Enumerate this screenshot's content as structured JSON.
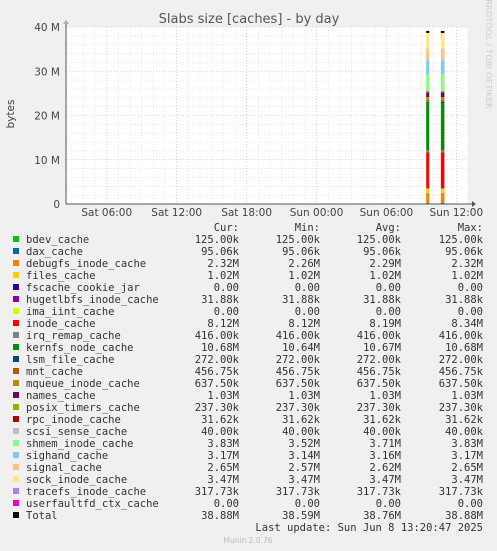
{
  "chart_data": {
    "type": "area",
    "title": "Slabs size [caches] - by day",
    "ylabel": "bytes",
    "side_label": "RRDTOOL / TOBI OETIKER",
    "y_ticks": [
      {
        "value": 0,
        "label": "0"
      },
      {
        "value": 10000000,
        "label": "10 M"
      },
      {
        "value": 20000000,
        "label": "20 M"
      },
      {
        "value": 30000000,
        "label": "30 M"
      },
      {
        "value": 40000000,
        "label": "40 M"
      }
    ],
    "ylim": [
      0,
      40000000
    ],
    "x_range_hours": [
      -33.5,
      1.0
    ],
    "x_ticks": [
      {
        "hour": -30,
        "label": "Sat 06:00"
      },
      {
        "hour": -24,
        "label": "Sat 12:00"
      },
      {
        "hour": -18,
        "label": "Sat 18:00"
      },
      {
        "hour": -12,
        "label": "Sun 00:00"
      },
      {
        "hour": -6,
        "label": "Sun 06:00"
      },
      {
        "hour": 0,
        "label": "Sun 12:00"
      }
    ],
    "data_start_hours": [
      -2.5,
      -1.2
    ],
    "columns": [
      "Cur:",
      "Min:",
      "Avg:",
      "Max:"
    ],
    "series": [
      {
        "name": "bdev_cache",
        "color": "#00cc00",
        "value": 125000,
        "cur": "125.00k",
        "min": "125.00k",
        "avg": "125.00k",
        "max": "125.00k"
      },
      {
        "name": "dax_cache",
        "color": "#0066b3",
        "value": 95060,
        "cur": "95.06k",
        "min": "95.06k",
        "avg": "95.06k",
        "max": "95.06k"
      },
      {
        "name": "debugfs_inode_cache",
        "color": "#ff8000",
        "value": 2320000,
        "cur": "2.32M",
        "min": "2.26M",
        "avg": "2.29M",
        "max": "2.32M"
      },
      {
        "name": "files_cache",
        "color": "#ffcc00",
        "value": 1020000,
        "cur": "1.02M",
        "min": "1.02M",
        "avg": "1.02M",
        "max": "1.02M"
      },
      {
        "name": "fscache_cookie_jar",
        "color": "#330099",
        "value": 0,
        "cur": "0.00",
        "min": "0.00",
        "avg": "0.00",
        "max": "0.00"
      },
      {
        "name": "hugetlbfs_inode_cache",
        "color": "#990099",
        "value": 31880,
        "cur": "31.88k",
        "min": "31.88k",
        "avg": "31.88k",
        "max": "31.88k"
      },
      {
        "name": "ima_iint_cache",
        "color": "#ccff00",
        "value": 0,
        "cur": "0.00",
        "min": "0.00",
        "avg": "0.00",
        "max": "0.00"
      },
      {
        "name": "inode_cache",
        "color": "#ff0000",
        "value": 8120000,
        "cur": "8.12M",
        "min": "8.12M",
        "avg": "8.19M",
        "max": "8.34M"
      },
      {
        "name": "irq_remap_cache",
        "color": "#808080",
        "value": 416000,
        "cur": "416.00k",
        "min": "416.00k",
        "avg": "416.00k",
        "max": "416.00k"
      },
      {
        "name": "kernfs_node_cache",
        "color": "#008f00",
        "value": 10680000,
        "cur": "10.68M",
        "min": "10.64M",
        "avg": "10.67M",
        "max": "10.68M"
      },
      {
        "name": "lsm_file_cache",
        "color": "#00487d",
        "value": 272000,
        "cur": "272.00k",
        "min": "272.00k",
        "avg": "272.00k",
        "max": "272.00k"
      },
      {
        "name": "mnt_cache",
        "color": "#b35a00",
        "value": 456750,
        "cur": "456.75k",
        "min": "456.75k",
        "avg": "456.75k",
        "max": "456.75k"
      },
      {
        "name": "mqueue_inode_cache",
        "color": "#b38f00",
        "value": 637500,
        "cur": "637.50k",
        "min": "637.50k",
        "avg": "637.50k",
        "max": "637.50k"
      },
      {
        "name": "names_cache",
        "color": "#6b006b",
        "value": 1030000,
        "cur": "1.03M",
        "min": "1.03M",
        "avg": "1.03M",
        "max": "1.03M"
      },
      {
        "name": "posix_timers_cache",
        "color": "#8fb300",
        "value": 237300,
        "cur": "237.30k",
        "min": "237.30k",
        "avg": "237.30k",
        "max": "237.30k"
      },
      {
        "name": "rpc_inode_cache",
        "color": "#b30000",
        "value": 31620,
        "cur": "31.62k",
        "min": "31.62k",
        "avg": "31.62k",
        "max": "31.62k"
      },
      {
        "name": "scsi_sense_cache",
        "color": "#bebebe",
        "value": 40000,
        "cur": "40.00k",
        "min": "40.00k",
        "avg": "40.00k",
        "max": "40.00k"
      },
      {
        "name": "shmem_inode_cache",
        "color": "#80ff80",
        "value": 3830000,
        "cur": "3.83M",
        "min": "3.52M",
        "avg": "3.71M",
        "max": "3.83M"
      },
      {
        "name": "sighand_cache",
        "color": "#80c9ff",
        "value": 3170000,
        "cur": "3.17M",
        "min": "3.14M",
        "avg": "3.16M",
        "max": "3.17M"
      },
      {
        "name": "signal_cache",
        "color": "#ffc080",
        "value": 2650000,
        "cur": "2.65M",
        "min": "2.57M",
        "avg": "2.62M",
        "max": "2.65M"
      },
      {
        "name": "sock_inode_cache",
        "color": "#ffe680",
        "value": 3470000,
        "cur": "3.47M",
        "min": "3.47M",
        "avg": "3.47M",
        "max": "3.47M"
      },
      {
        "name": "tracefs_inode_cache",
        "color": "#aa80ff",
        "value": 317730,
        "cur": "317.73k",
        "min": "317.73k",
        "avg": "317.73k",
        "max": "317.73k"
      },
      {
        "name": "userfaultfd_ctx_cache",
        "color": "#ee00cc",
        "value": 0,
        "cur": "0.00",
        "min": "0.00",
        "avg": "0.00",
        "max": "0.00"
      },
      {
        "name": "Total",
        "color": "#000000",
        "value": 38880000,
        "cur": "38.88M",
        "min": "38.59M",
        "avg": "38.76M",
        "max": "38.88M",
        "is_total": true
      }
    ],
    "last_update": "Last update: Sun Jun  8 13:20:47 2025",
    "footer": "Munin 2.0.76"
  }
}
